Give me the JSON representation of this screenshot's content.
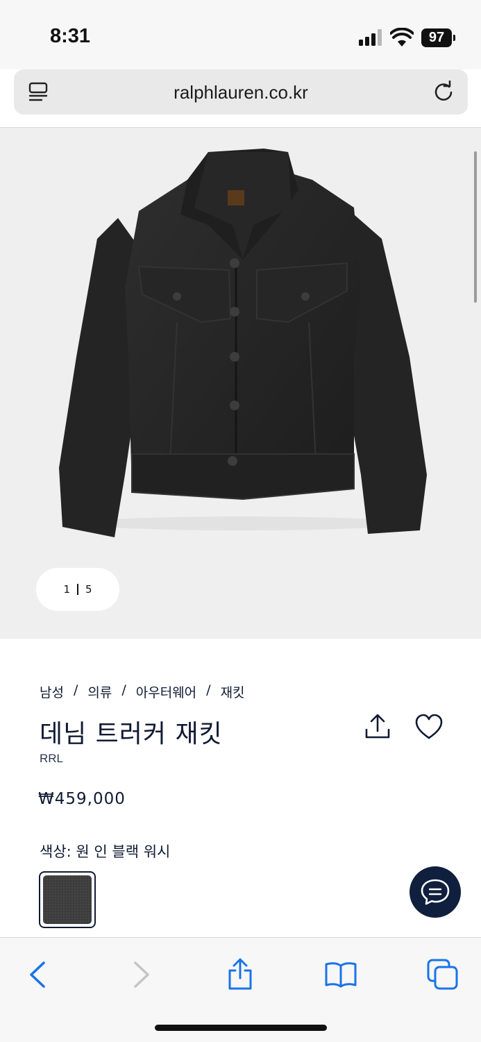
{
  "status_bar": {
    "time": "8:31",
    "battery": "97"
  },
  "browser": {
    "url": "ralphlauren.co.kr"
  },
  "gallery": {
    "current": "1",
    "total": "5"
  },
  "product": {
    "breadcrumb": [
      "남성",
      "의류",
      "아우터웨어",
      "재킷"
    ],
    "breadcrumb_separator": "/",
    "title": "데님 트러커 재킷",
    "brand": "RRL",
    "price": "₩459,000",
    "color_label": "색상: 원 인 블랙 워시"
  },
  "colors": {
    "accent": "#0f1a33",
    "toolbar_icon": "#1a73e8"
  },
  "icons": {
    "reader": "reader-mode-icon",
    "reload": "reload-icon",
    "share": "share-icon",
    "favorite": "heart-icon",
    "chat": "chat-icon",
    "back": "chevron-left-icon",
    "forward": "chevron-right-icon",
    "browser_share": "share-icon",
    "bookmarks": "book-icon",
    "tabs": "tabs-icon"
  }
}
